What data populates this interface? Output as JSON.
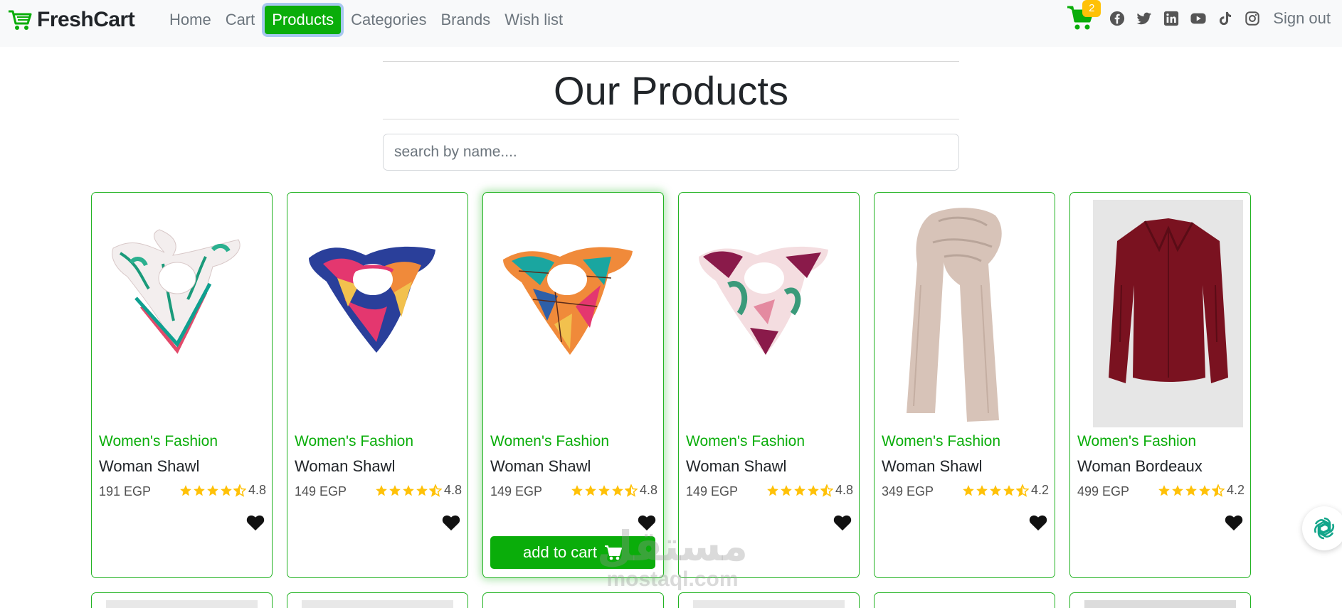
{
  "brand": {
    "name": "FreshCart"
  },
  "nav": {
    "links": [
      "Home",
      "Cart",
      "Products",
      "Categories",
      "Brands",
      "Wish list"
    ],
    "active": "Products",
    "cart_count": "2",
    "social_icons": [
      "facebook-icon",
      "twitter-icon",
      "linkedin-icon",
      "youtube-icon",
      "tiktok-icon",
      "instagram-icon"
    ],
    "signout_label": "Sign out"
  },
  "page": {
    "title": "Our Products",
    "search_placeholder": "search by name....",
    "search_value": ""
  },
  "products": [
    {
      "category": "Women's Fashion",
      "name": "Woman Shawl",
      "price": "191 EGP",
      "rating": "4.8",
      "image": "scarf-white-green"
    },
    {
      "category": "Women's Fashion",
      "name": "Woman Shawl",
      "price": "149 EGP",
      "rating": "4.8",
      "image": "scarf-navy-pink"
    },
    {
      "category": "Women's Fashion",
      "name": "Woman Shawl",
      "price": "149 EGP",
      "rating": "4.8",
      "image": "scarf-orange-teal",
      "add_to_cart_label": "add to cart"
    },
    {
      "category": "Women's Fashion",
      "name": "Woman Shawl",
      "price": "149 EGP",
      "rating": "4.8",
      "image": "scarf-purple-pink"
    },
    {
      "category": "Women's Fashion",
      "name": "Woman Shawl",
      "price": "349 EGP",
      "rating": "4.2",
      "image": "scarf-beige"
    },
    {
      "category": "Women's Fashion",
      "name": "Woman Bordeaux",
      "price": "499 EGP",
      "rating": "4.2",
      "image": "shirt-bordeaux"
    }
  ],
  "watermark": {
    "arabic": "مستقل",
    "latin": "mostaql.com"
  },
  "colors": {
    "accent": "#0aad0a",
    "star": "#ffc107",
    "badge": "#ffc107"
  }
}
